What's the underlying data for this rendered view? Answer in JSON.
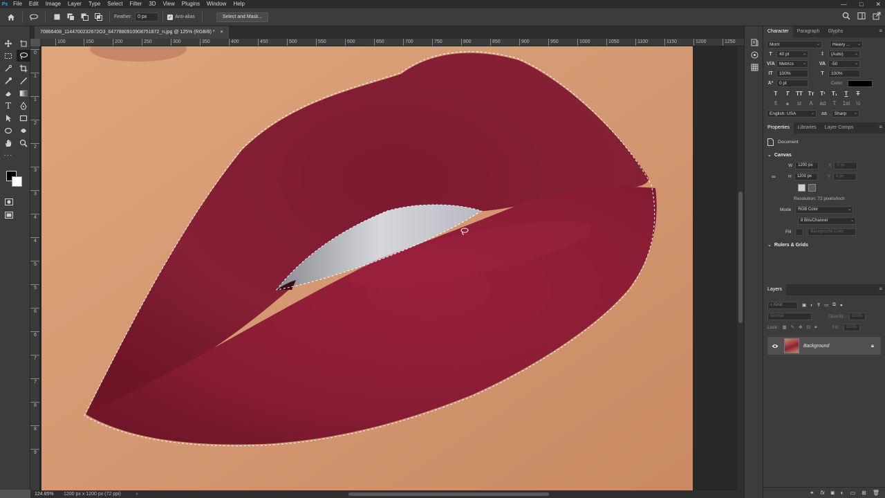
{
  "menubar": {
    "app_icon": "Ps",
    "items": [
      "File",
      "Edit",
      "Image",
      "Layer",
      "Type",
      "Select",
      "Filter",
      "3D",
      "View",
      "Plugins",
      "Window",
      "Help"
    ],
    "controls": [
      "—",
      "□",
      "✕"
    ]
  },
  "options_bar": {
    "feather_label": "Feather:",
    "feather_value": "0 px",
    "antialias_label": "Anti-alias",
    "select_mask_label": "Select and Mask..."
  },
  "document": {
    "tab_title": "70866408_1144700232672O3_6477880910908751872_n.jpg @ 125% (RGB/8) *",
    "close": "×"
  },
  "rulers": {
    "horizontal": [
      "100",
      "150",
      "200",
      "250",
      "300",
      "350",
      "400",
      "450",
      "500",
      "550",
      "600",
      "650",
      "700",
      "750",
      "800",
      "850",
      "900",
      "950",
      "1000",
      "1050",
      "1100",
      "1150",
      "1200",
      "1250"
    ],
    "vertical": [
      "0",
      "1",
      "1",
      "2",
      "2",
      "3",
      "3",
      "4",
      "4",
      "5",
      "5",
      "6",
      "6",
      "7",
      "7",
      "8",
      "8",
      "9"
    ]
  },
  "status": {
    "zoom": "124.85%",
    "doc_info": "1200 px x 1200 px (72 ppi)",
    "arrow": "›"
  },
  "character": {
    "tabs": [
      "Character",
      "Paragraph",
      "Glyphs"
    ],
    "font_family": "Mont",
    "font_style": "Heavy ...",
    "font_size": "40 pt",
    "leading": "(Auto)",
    "kerning": "Metrics",
    "tracking": "-50",
    "vertical_scale": "100%",
    "horizontal_scale": "100%",
    "baseline_shift": "0 pt",
    "color_label": "Color:",
    "color_value": "#000000",
    "typo_row1": [
      "T",
      "T",
      "TT",
      "Tт",
      "T¹",
      "T₁",
      "T",
      "T"
    ],
    "typo_row2": [
      "fi",
      "ℴ",
      "st",
      "A",
      "ad",
      "T",
      "1st",
      "½"
    ],
    "language": "English: USA",
    "aa_icon": "aa",
    "antialias": "Sharp"
  },
  "properties": {
    "tabs": [
      "Properties",
      "Libraries",
      "Layer Comps"
    ],
    "kind": "Document",
    "canvas_label": "Canvas",
    "w_label": "W",
    "w_value": "1200 px",
    "h_label": "H",
    "h_value": "1200 px",
    "x_label": "X",
    "x_value": "0 px",
    "y_label": "Y",
    "y_value": "0 px",
    "resolution": "Resolution: 72 pixels/inch",
    "mode_label": "Mode",
    "mode_value": "RGB Color",
    "depth_value": "8 Bits/Channel",
    "fill_label": "Fill",
    "fill_value": "Background Color",
    "rulers_grids": "Rulers & Grids"
  },
  "layers": {
    "title": "Layers",
    "kind_placeholder": "Kind",
    "blend_mode": "Normal",
    "opacity_label": "Opacity:",
    "opacity_value": "100%",
    "lock_label": "Lock:",
    "fill_label": "Fill:",
    "fill_value": "100%",
    "items": [
      {
        "name": "Background",
        "visible": true,
        "locked": true
      }
    ],
    "bottom_icons": [
      "link-icon",
      "fx-icon",
      "mask-icon",
      "adjustment-icon",
      "group-icon",
      "new-layer-icon",
      "trash-icon"
    ]
  },
  "colors": {
    "lip": "#8a1e33",
    "skin": "#d79a72",
    "accent": "#31a8ff"
  }
}
